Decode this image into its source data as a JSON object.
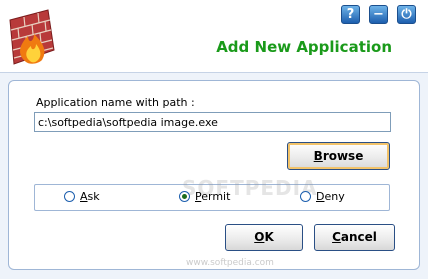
{
  "header": {
    "title": "Add New Application",
    "controls": [
      {
        "name": "help-icon",
        "glyph": "?"
      },
      {
        "name": "minimize-icon",
        "glyph": "−"
      },
      {
        "name": "power-icon",
        "glyph": "⏻"
      }
    ]
  },
  "form": {
    "path_label": "Application name with path  :",
    "path_value": "c:\\softpedia\\softpedia image.exe",
    "browse_label": "Browse",
    "browse_mnemonic": "B",
    "browse_rest": "rowse"
  },
  "access": {
    "options": [
      {
        "mnemonic": "A",
        "rest": "sk",
        "label": "Ask",
        "selected": false
      },
      {
        "mnemonic": "P",
        "rest": "ermit",
        "label": "Permit",
        "selected": true
      },
      {
        "mnemonic": "D",
        "rest": "eny",
        "label": "Deny",
        "selected": false
      }
    ]
  },
  "buttons": {
    "ok_mnemonic": "O",
    "ok_rest": "K",
    "cancel_mnemonic": "C",
    "cancel_rest": "ancel"
  },
  "watermark": {
    "text": "SOFTPEDIA",
    "url": "www.softpedia.com"
  },
  "colors": {
    "title": "#1a9a1a",
    "accent": "#1d5fae",
    "panel_bg": "#eef3fa"
  }
}
